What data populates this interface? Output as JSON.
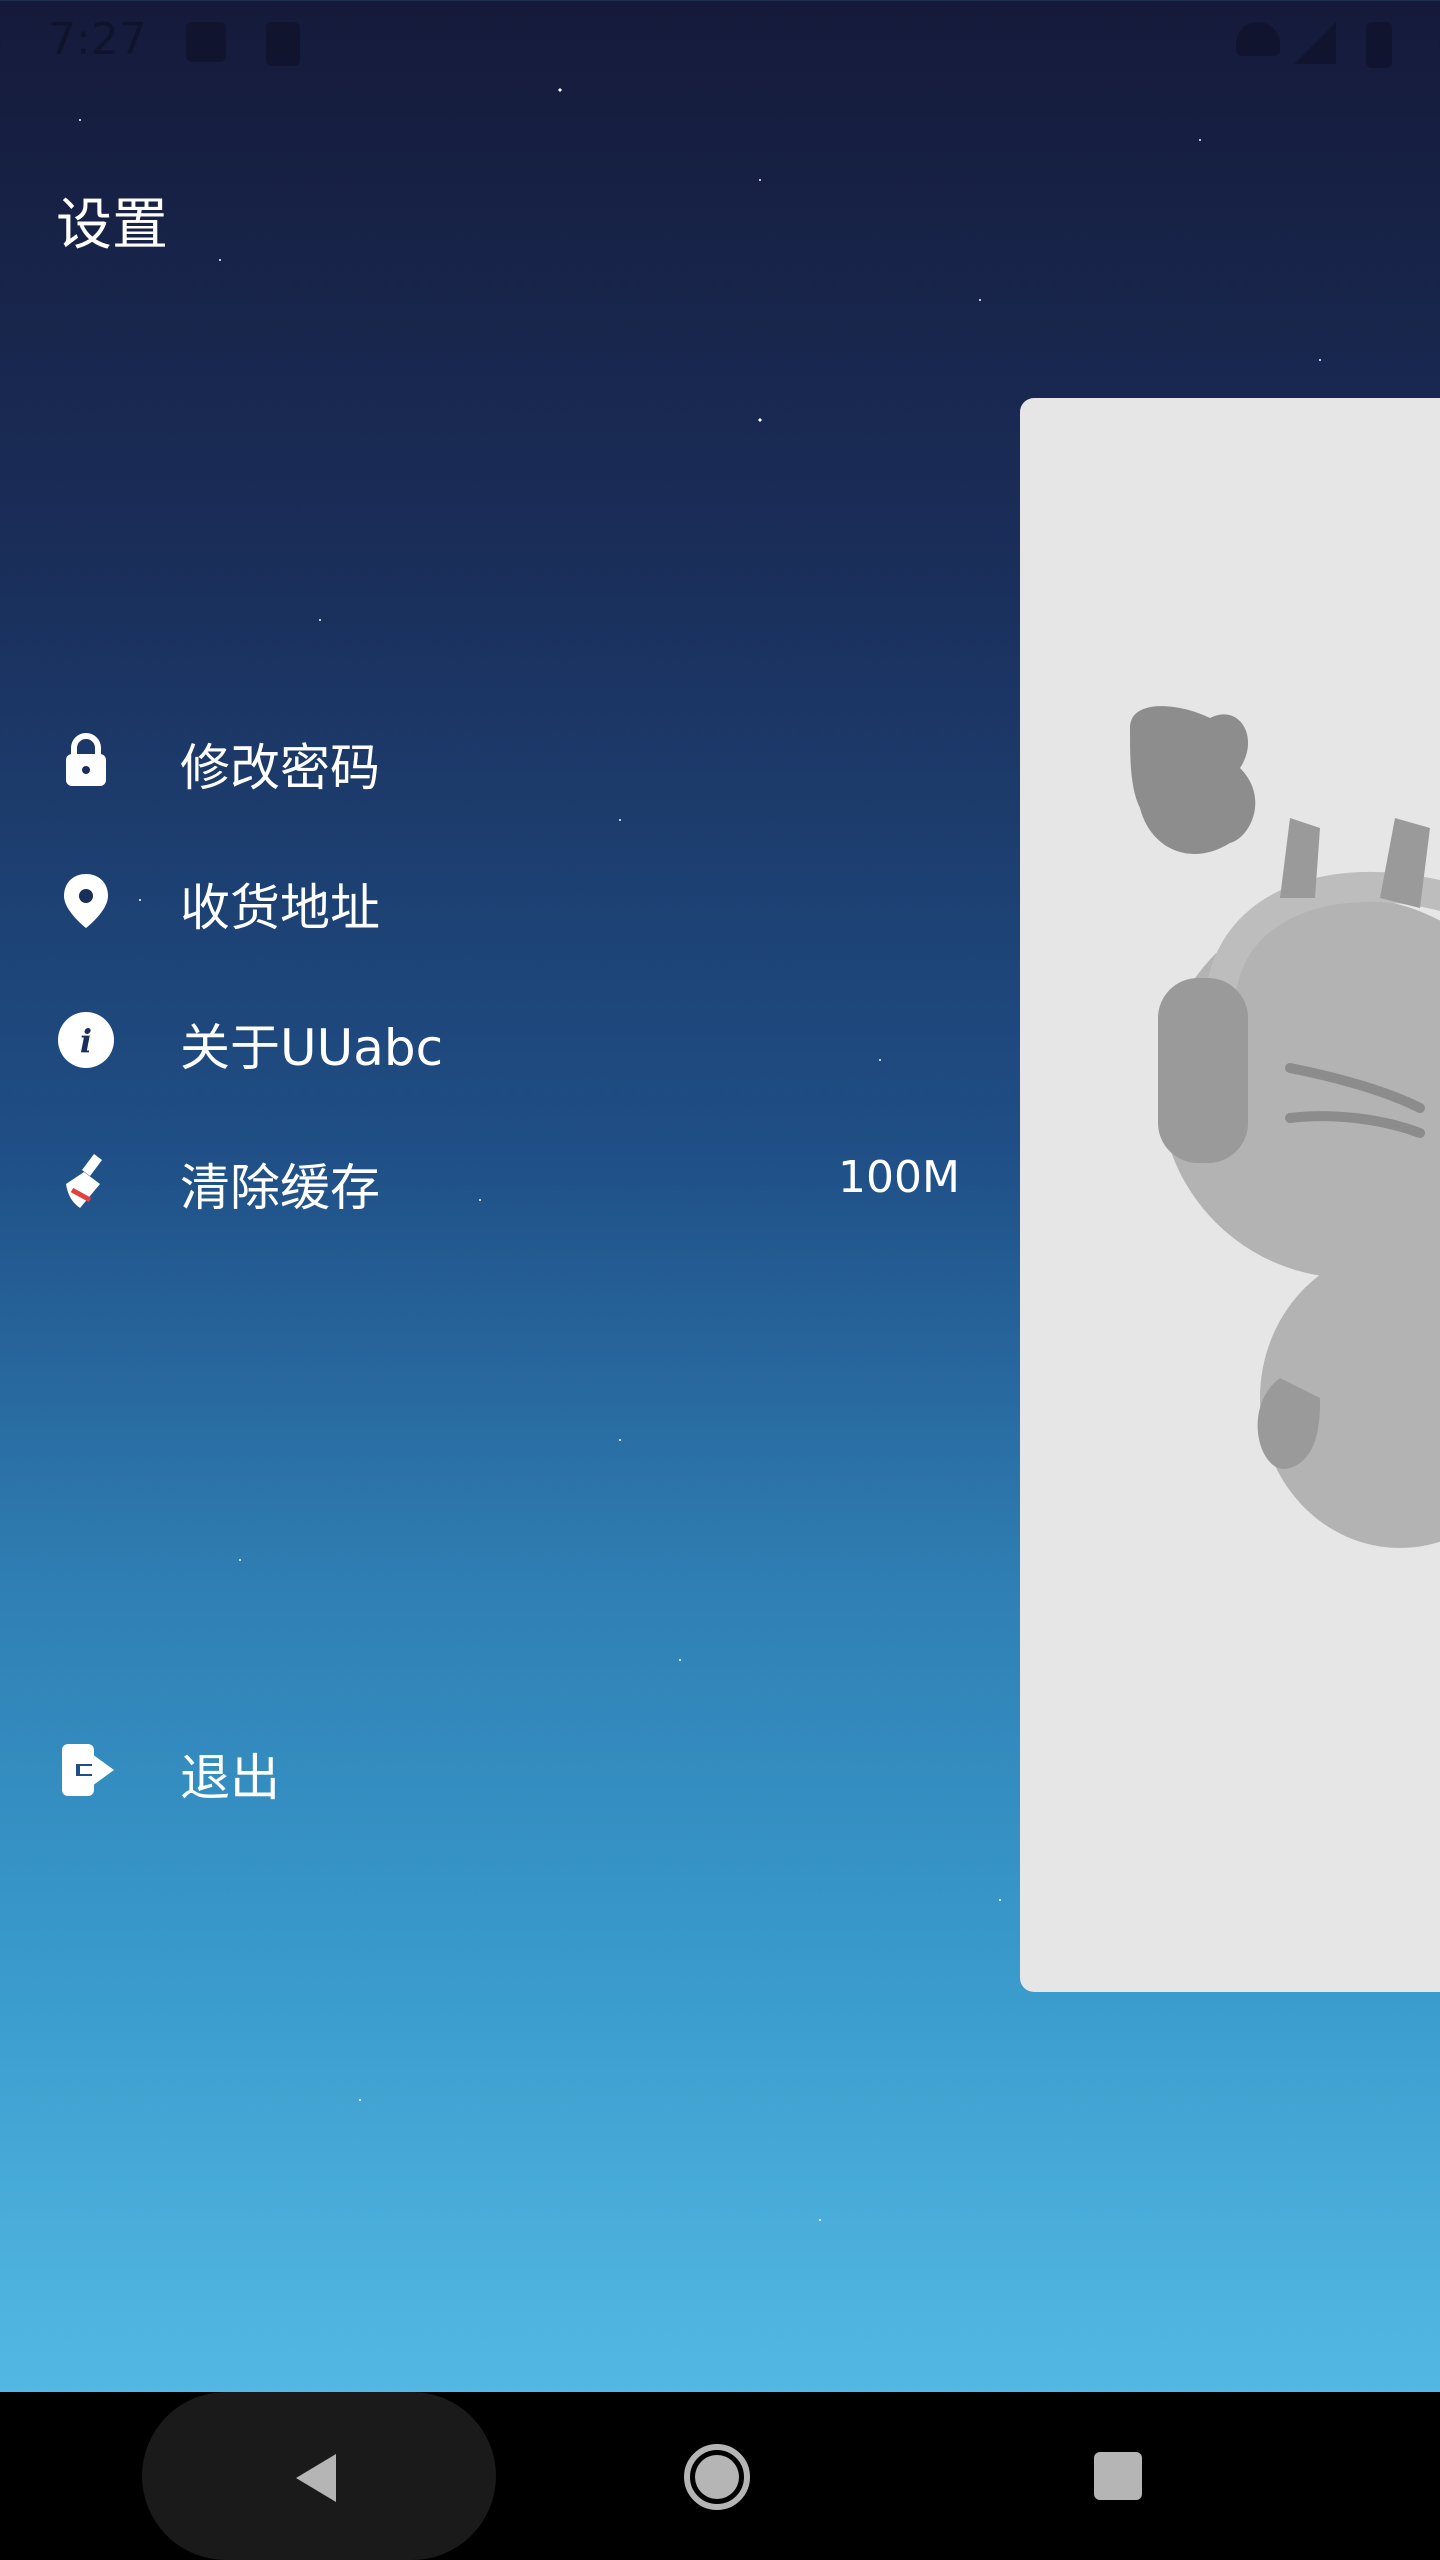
{
  "status_bar": {
    "time": "7:27",
    "left_icons": [
      "adobe-icon",
      "sd-card-icon"
    ],
    "right_icons": [
      "wifi-icon",
      "signal-icon",
      "battery-icon"
    ]
  },
  "header": {
    "title": "设置"
  },
  "menu": {
    "items": [
      {
        "label": "修改密码",
        "icon": "lock-icon"
      },
      {
        "label": "收货地址",
        "icon": "location-pin-icon"
      },
      {
        "label": "关于UUabc",
        "icon": "info-icon"
      },
      {
        "label": "清除缓存",
        "icon": "broom-icon",
        "value": "100M"
      }
    ],
    "logout": {
      "label": "退出",
      "icon": "logout-icon"
    }
  },
  "preview_panel": {
    "icon": "mascot-illustration"
  },
  "nav_bar": {
    "icons": [
      "back-icon",
      "home-icon",
      "recent-apps-icon"
    ]
  }
}
